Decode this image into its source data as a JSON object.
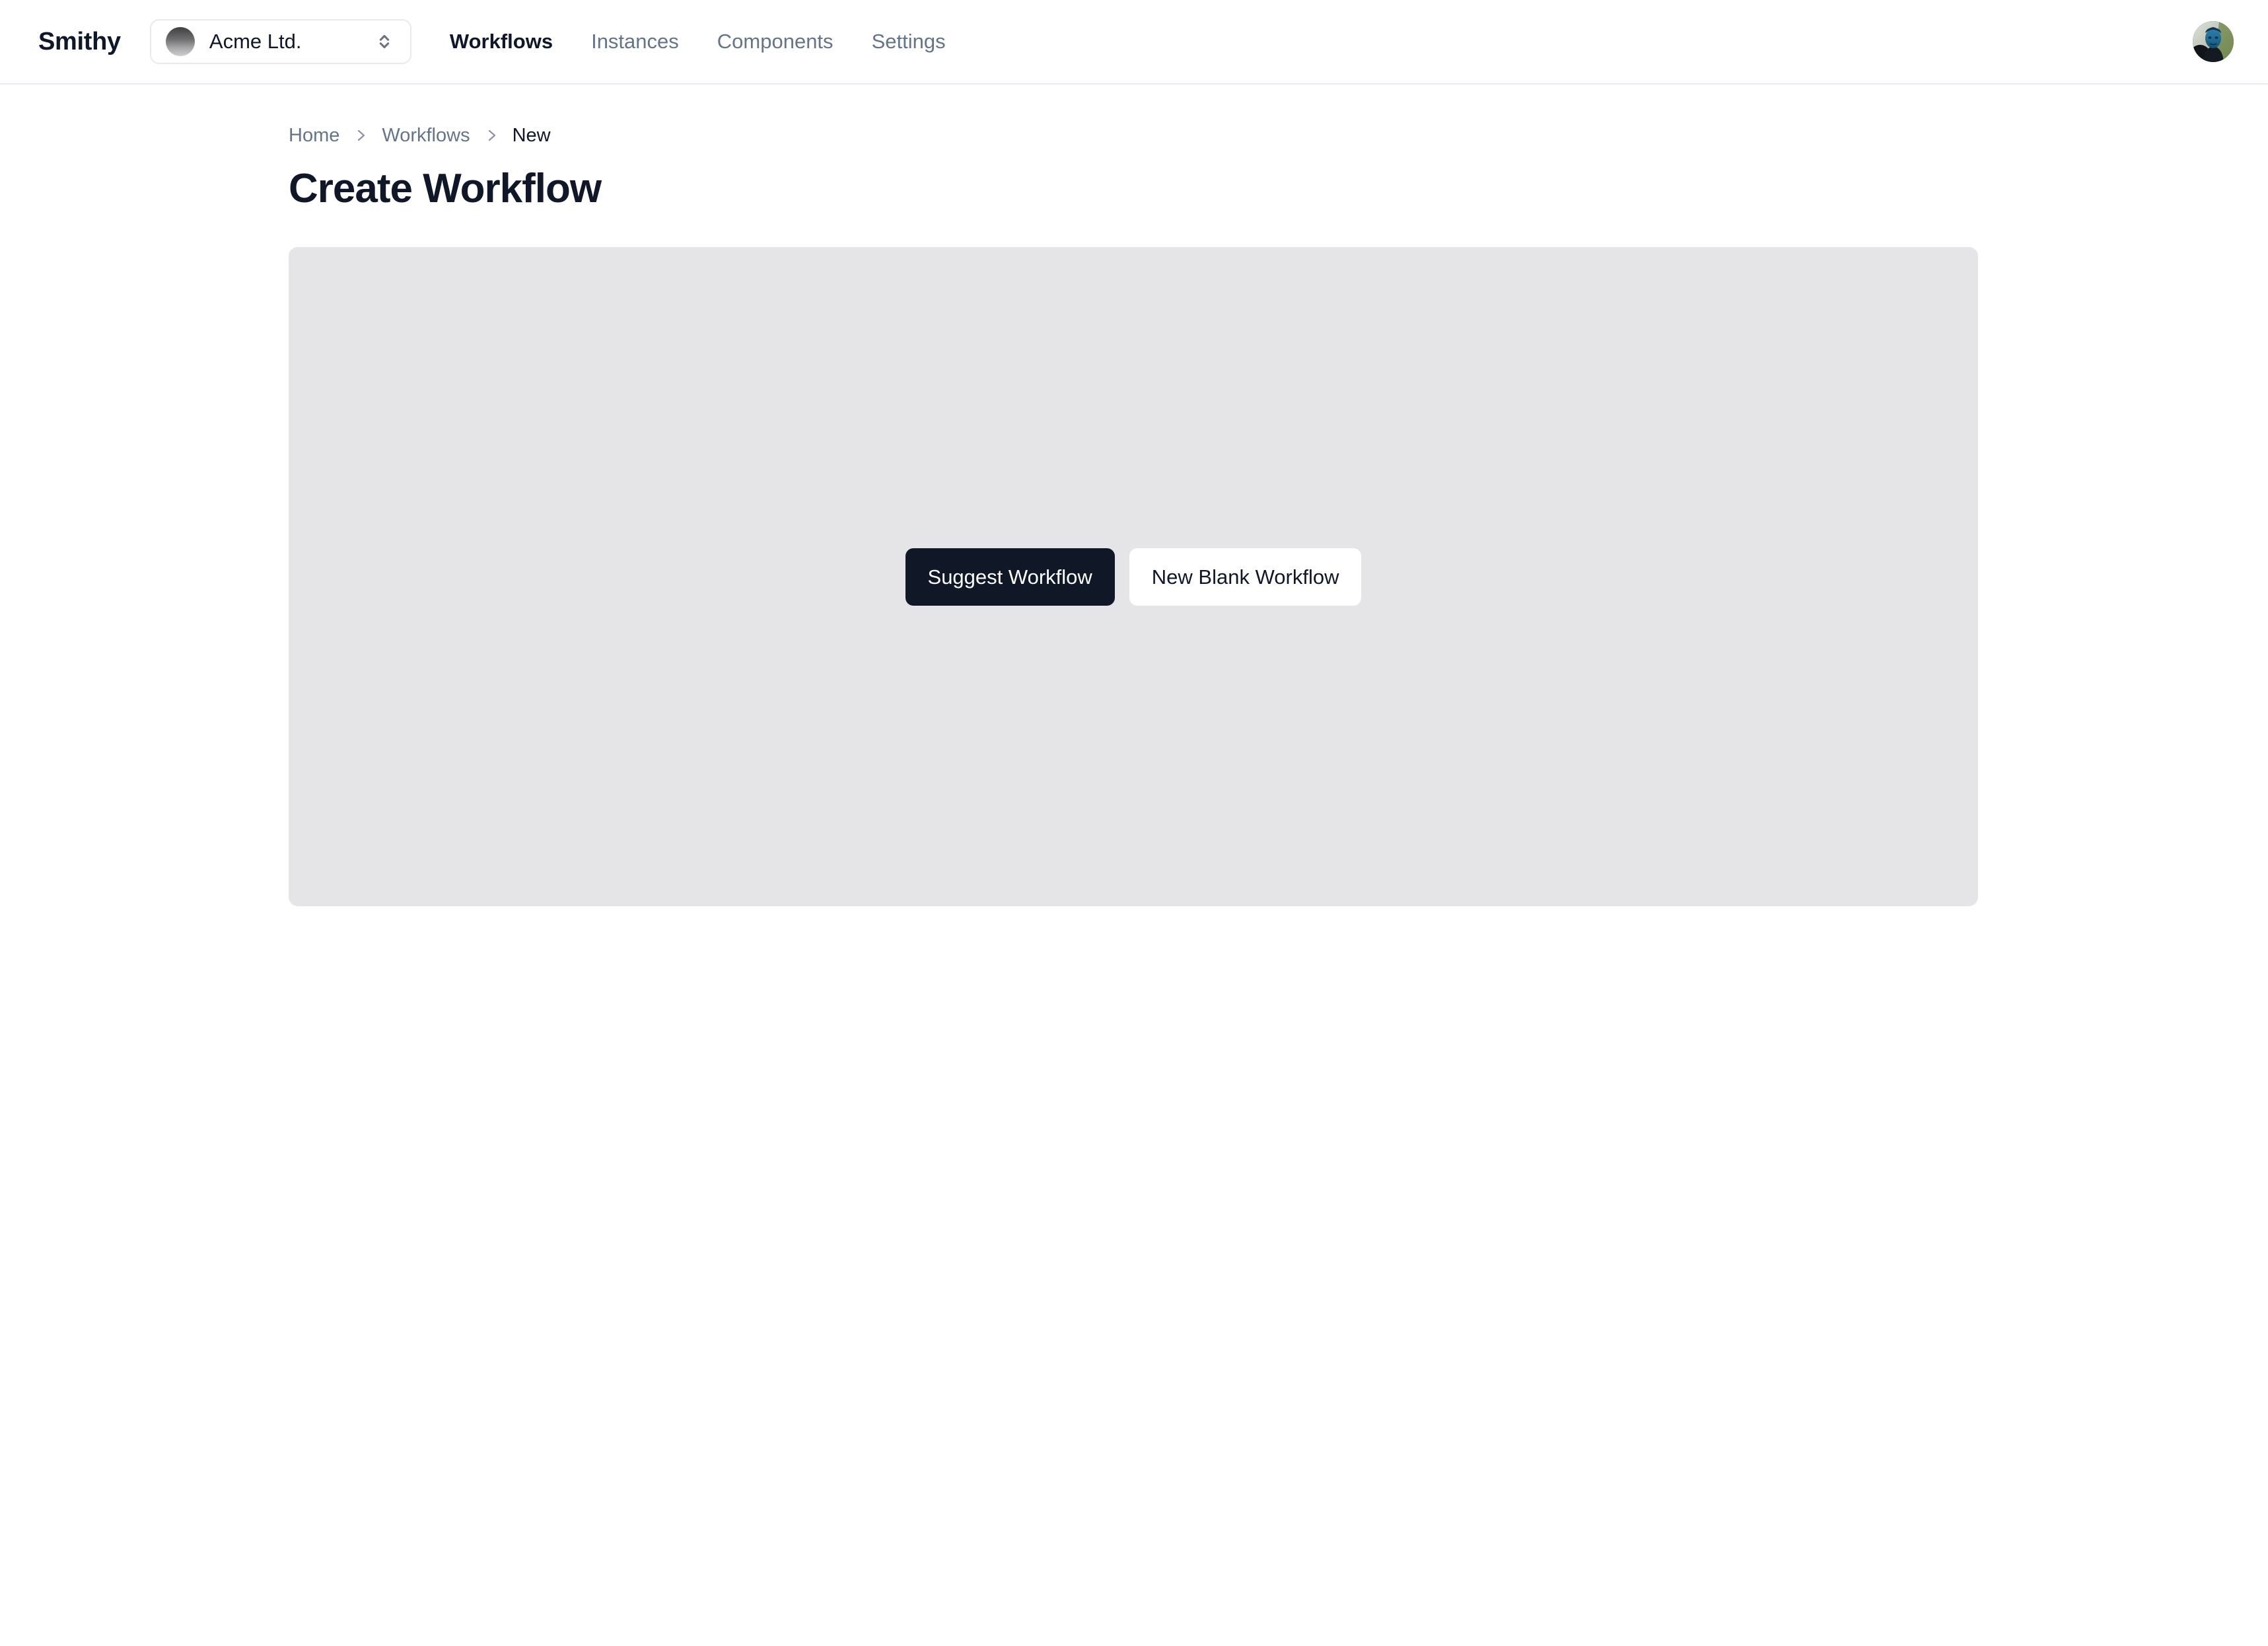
{
  "header": {
    "brand": "Smithy",
    "org_switcher": {
      "name": "Acme Ltd.",
      "avatar_icon": "org-avatar-gradient-circle",
      "selector_icon": "chevron-up-down-icon"
    },
    "nav": [
      {
        "label": "Workflows",
        "active": true
      },
      {
        "label": "Instances",
        "active": false
      },
      {
        "label": "Components",
        "active": false
      },
      {
        "label": "Settings",
        "active": false
      }
    ],
    "user_avatar_icon": "user-avatar-photo"
  },
  "breadcrumb": {
    "separator_icon": "chevron-right-icon",
    "items": [
      {
        "label": "Home",
        "current": false
      },
      {
        "label": "Workflows",
        "current": false
      },
      {
        "label": "New",
        "current": true
      }
    ]
  },
  "page": {
    "title": "Create Workflow"
  },
  "canvas": {
    "actions": {
      "primary_label": "Suggest Workflow",
      "secondary_label": "New Blank Workflow"
    }
  },
  "colors": {
    "brand_dark": "#0f172a",
    "primary_button_bg": "#101828",
    "muted_text": "#64748b",
    "canvas_bg": "#e5e5e7",
    "header_border": "#e6e9ef"
  }
}
